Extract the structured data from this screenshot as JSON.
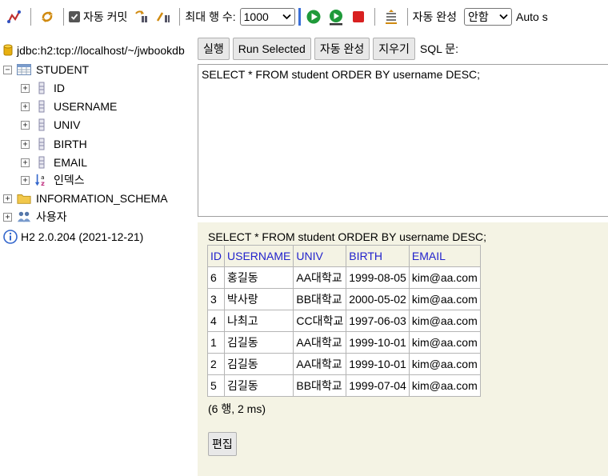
{
  "toolbar": {
    "auto_commit_label": "자동 커밋",
    "max_rows_label": "최대 행 수:",
    "max_rows_value": "1000",
    "auto_complete_label": "자동 완성",
    "auto_complete_value": "안함",
    "auto_select_label": "Auto s"
  },
  "tree": {
    "connection": "jdbc:h2:tcp://localhost/~/jwbookdb",
    "table_name": "STUDENT",
    "columns": [
      "ID",
      "USERNAME",
      "UNIV",
      "BIRTH",
      "EMAIL"
    ],
    "indexes_label": "인덱스",
    "info_schema": "INFORMATION_SCHEMA",
    "users_label": "사용자",
    "version": "H2 2.0.204 (2021-12-21)"
  },
  "buttons": {
    "run": "실행",
    "run_selected": "Run Selected",
    "auto_complete": "자동 완성",
    "clear": "지우기",
    "sql_label": "SQL 문:"
  },
  "editor": {
    "sql": "SELECT * FROM student ORDER BY username DESC;"
  },
  "result": {
    "query": "SELECT * FROM student ORDER BY username DESC;",
    "headers": [
      "ID",
      "USERNAME",
      "UNIV",
      "BIRTH",
      "EMAIL"
    ],
    "rows": [
      [
        "6",
        "홍길동",
        "AA대학교",
        "1999-08-05",
        "kim@aa.com"
      ],
      [
        "3",
        "박사랑",
        "BB대학교",
        "2000-05-02",
        "kim@aa.com"
      ],
      [
        "4",
        "나최고",
        "CC대학교",
        "1997-06-03",
        "kim@aa.com"
      ],
      [
        "1",
        "김길동",
        "AA대학교",
        "1999-10-01",
        "kim@aa.com"
      ],
      [
        "2",
        "김길동",
        "AA대학교",
        "1999-10-01",
        "kim@aa.com"
      ],
      [
        "5",
        "김길동",
        "BB대학교",
        "1999-07-04",
        "kim@aa.com"
      ]
    ],
    "count": "(6 행, 2 ms)",
    "edit_button": "편집"
  }
}
